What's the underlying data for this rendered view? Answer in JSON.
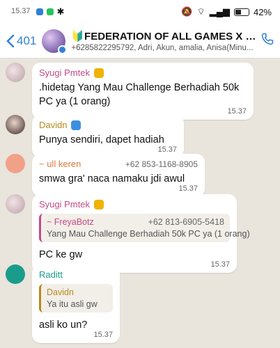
{
  "status_bar": {
    "time": "15.37",
    "battery": "42%"
  },
  "header": {
    "back_count": "401",
    "title": "🔰FEDERATION OF ALL GAMES X U...",
    "subtitle": "+6285822295792, Adri, Akun, amalia, Anisa(Minu..."
  },
  "messages": [
    {
      "sender": "Syugi Pmtek",
      "text": ".hidetag Yang Mau Challenge Berhadiah 50k PC ya (1 orang)",
      "time": "15.37"
    },
    {
      "sender": "Davidn",
      "text": "Punya sendiri, dapet hadiah",
      "time": "15.37"
    },
    {
      "sender": "~ ull keren",
      "phone": "+62 853-1168-8905",
      "text": "smwa gra' naca namaku jdi awul",
      "time": "15.37"
    },
    {
      "sender": "Syugi Pmtek",
      "quote": {
        "name": "~ FreyaBotz",
        "phone": "+62 813-6905-5418",
        "text": "Yang Mau Challenge Berhadiah 50k PC ya (1 orang)"
      },
      "text": "PC ke gw",
      "time": "15.37"
    },
    {
      "sender": "Raditt",
      "quote": {
        "name": "Davidn",
        "text": "Ya itu asli gw"
      },
      "text": "asli ko un?",
      "time": "15.37"
    }
  ],
  "colors": {
    "accent": "#2f80d6",
    "syugi": "#c24a86",
    "davidn": "#b88a1c",
    "ull": "#e07a3c",
    "raditt": "#1a9c8c"
  }
}
